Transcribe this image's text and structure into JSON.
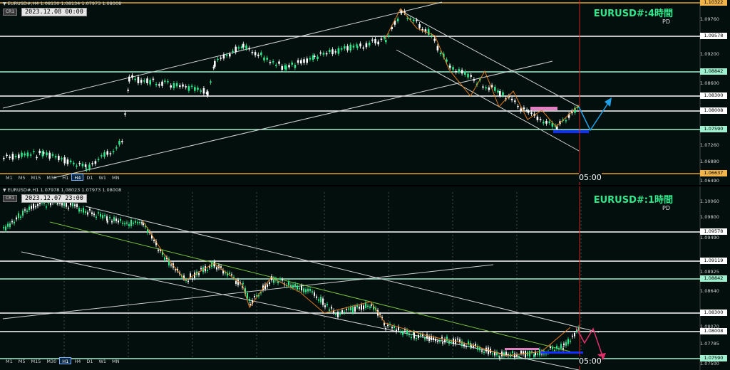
{
  "colors": {
    "background": "#020f0d",
    "bull_candle": "#2ee88c",
    "bear_candle": "#ffffff",
    "white_level": "#ffffff",
    "green_level": "#9ff0d0",
    "orange_level": "#e0a030",
    "channel": "#d0d0d0",
    "zigzag": "#e07b1b",
    "title_green": "#2ee88c",
    "vline_red": "#d02020",
    "arrow_up_blue": "#1da1e8",
    "arrow_down_pink": "#e0306a",
    "pink_box": "#e080c0",
    "blue_box": "#1030ff"
  },
  "top": {
    "header": "EURUSD#,H4  1.08130 1.08134 1.07973 1.08008",
    "datetime": "2023.12.08 00:00",
    "btn_cr1": "CR1",
    "btn_r": "R",
    "title": "EURUSD#:4時間",
    "pd": "PD",
    "timeframes": [
      "M1",
      "M5",
      "M15",
      "M30",
      "H1",
      "H4",
      "D1",
      "W1",
      "MN"
    ],
    "active_tf": "H4",
    "time_label": "05:00",
    "levels": [
      {
        "price": "1.10322",
        "style": "orange"
      },
      {
        "price": "1.09578",
        "style": "white"
      },
      {
        "price": "1.08842",
        "style": "green"
      },
      {
        "price": "1.08300",
        "style": "white"
      },
      {
        "price": "1.08008",
        "style": "white"
      },
      {
        "price": "1.07590",
        "style": "green"
      },
      {
        "price": "1.06637",
        "style": "orange"
      }
    ],
    "ticks": [
      "1.09760",
      "1.09200",
      "1.08600",
      "1.07260",
      "1.06880",
      "1.06490"
    ]
  },
  "bottom": {
    "header": "EURUSD#,H1  1.07978 1.08023 1.07973 1.08008",
    "datetime": "2023.12.07 23:00",
    "btn_cr1": "CR1",
    "btn_r": "R",
    "title": "EURUSD#:1時間",
    "pd": "PD",
    "timeframes": [
      "M1",
      "M5",
      "M15",
      "M30",
      "H1",
      "H4",
      "D1",
      "W1",
      "MN"
    ],
    "active_tf": "H1",
    "time_label": "05:00",
    "levels": [
      {
        "price": "1.09578",
        "style": "white"
      },
      {
        "price": "1.09119",
        "style": "white"
      },
      {
        "price": "1.08842",
        "style": "green"
      },
      {
        "price": "1.08300",
        "style": "white"
      },
      {
        "price": "1.08008",
        "style": "white"
      },
      {
        "price": "1.07590",
        "style": "green"
      }
    ],
    "ticks": [
      "1.10060",
      "1.09800",
      "1.09490",
      "1.08925",
      "1.08640",
      "1.08070",
      "1.07785",
      "1.07500"
    ]
  }
}
